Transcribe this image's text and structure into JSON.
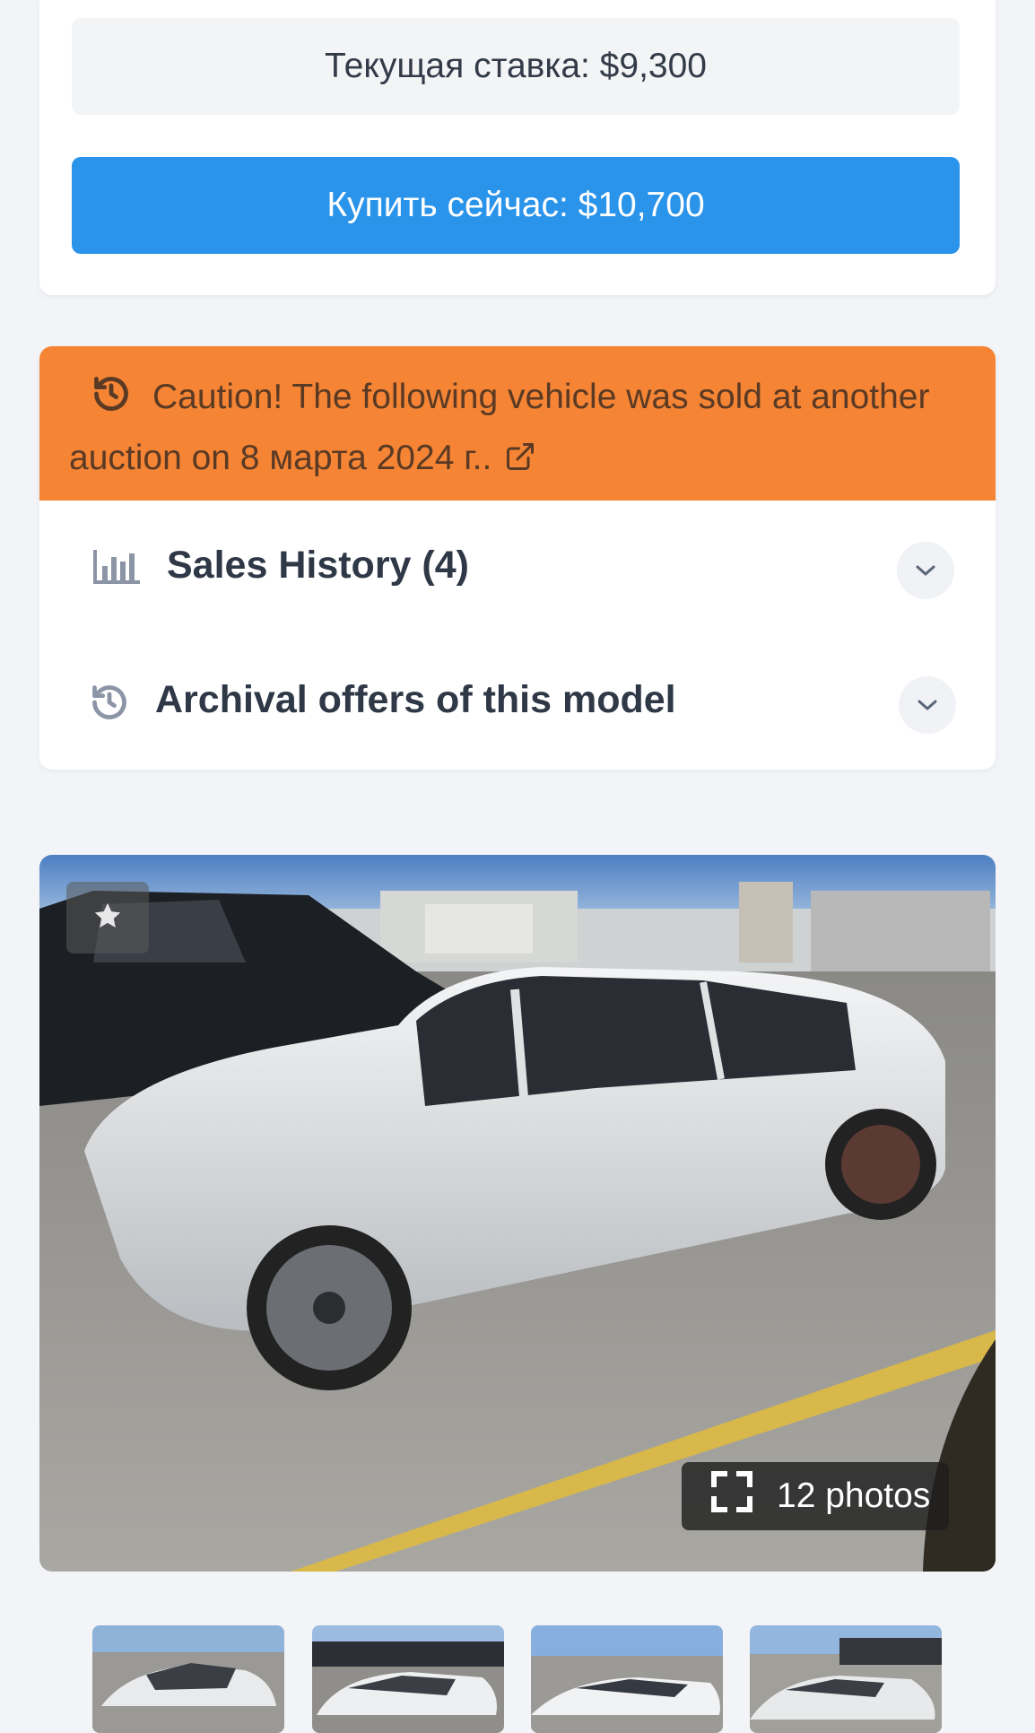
{
  "bid": {
    "current_bid": "Текущая ставка: $9,300",
    "buy_now": "Купить сейчас: $10,700"
  },
  "caution": {
    "text": "Caution! The following vehicle was sold at another auction on 8 марта 2024 г..",
    "icon": "history-icon",
    "link_icon": "external-link-icon"
  },
  "accordion": {
    "sales_history": "Sales History (4)",
    "archival_offers": "Archival offers of this model"
  },
  "gallery": {
    "photos_label": "12 photos",
    "thumbnail_count": 4
  },
  "colors": {
    "buy_now_bg": "#2a93ea",
    "caution_bg": "#f58434",
    "page_bg": "#f2f4f7"
  }
}
